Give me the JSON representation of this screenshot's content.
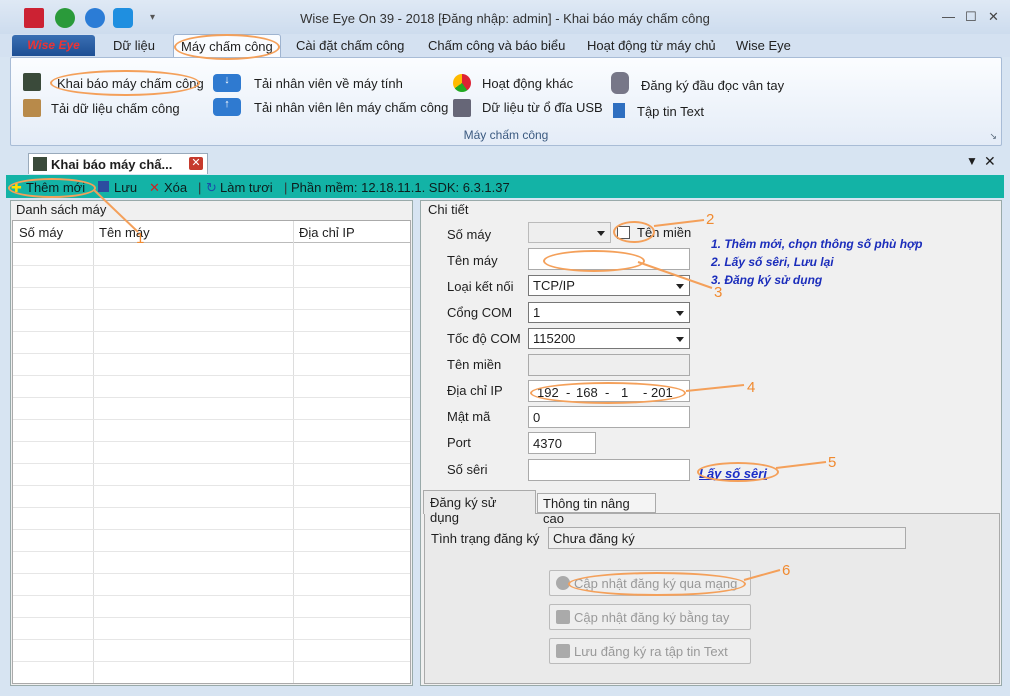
{
  "window": {
    "title": "Wise Eye On 39 - 2018 [Đăng nhập: admin] - Khai báo máy chấm công"
  },
  "menu": {
    "file": "Wise Eye",
    "tabs": [
      "Dữ liệu",
      "Máy chấm công",
      "Cài đặt chấm công",
      "Chấm công và báo biểu",
      "Hoạt động từ máy chủ",
      "Wise Eye"
    ]
  },
  "ribbon": {
    "items": [
      "Khai báo máy chấm công",
      "Tải dữ liệu chấm công",
      "Tải nhân viên về máy tính",
      "Tải nhân viên lên máy chấm công",
      "Hoạt động khác",
      "Dữ liệu từ ổ đĩa USB",
      "Đăng ký đầu đọc vân tay",
      "Tập tin Text"
    ],
    "group": "Máy chấm công"
  },
  "doc": {
    "tab": "Khai báo máy chấ..."
  },
  "toolbar": {
    "add": "Thêm mới",
    "save": "Lưu",
    "delete": "Xóa",
    "refresh": "Làm tươi",
    "version": "Phần mềm: 12.18.11.1. SDK: 6.3.1.37"
  },
  "list": {
    "title": "Danh sách máy",
    "columns": [
      "Số máy",
      "Tên máy",
      "Địa chỉ IP"
    ]
  },
  "detail": {
    "title": "Chi tiết",
    "labels": {
      "so_may": "Số máy",
      "ten_mien_cb": "Tên miền",
      "ten_may": "Tên máy",
      "loai": "Loại kết nối",
      "cong": "Cổng COM",
      "toc_do": "Tốc độ COM",
      "ten_mien": "Tên miền",
      "ip": "Địa chỉ IP",
      "mat_ma": "Mật mã",
      "port": "Port",
      "seri": "Số sêri"
    },
    "values": {
      "loai": "TCP/IP",
      "cong": "1",
      "toc_do": "115200",
      "ip": [
        "192",
        "168",
        "1",
        "201"
      ],
      "ip_dots": [
        "-",
        "-",
        "-"
      ],
      "mat_ma": "0",
      "port": "4370"
    },
    "link_seri": "Lấy số sêri",
    "notes": [
      "1. Thêm mới, chọn thông số phù hợp",
      "2. Lấy số sêri, Lưu lại",
      "3. Đăng ký sử dụng"
    ]
  },
  "reg": {
    "tabs": [
      "Đăng ký sử dụng",
      "Thông tin nâng cao"
    ],
    "status_label": "Tình trạng đăng ký",
    "status_value": "Chưa đăng ký",
    "buttons": [
      "Cập nhật đăng ký qua mạng",
      "Cập nhật đăng ký bằng tay",
      "Lưu đăng ký ra tập tin Text"
    ]
  },
  "annotations": [
    "1",
    "2",
    "3",
    "4",
    "5",
    "6"
  ]
}
